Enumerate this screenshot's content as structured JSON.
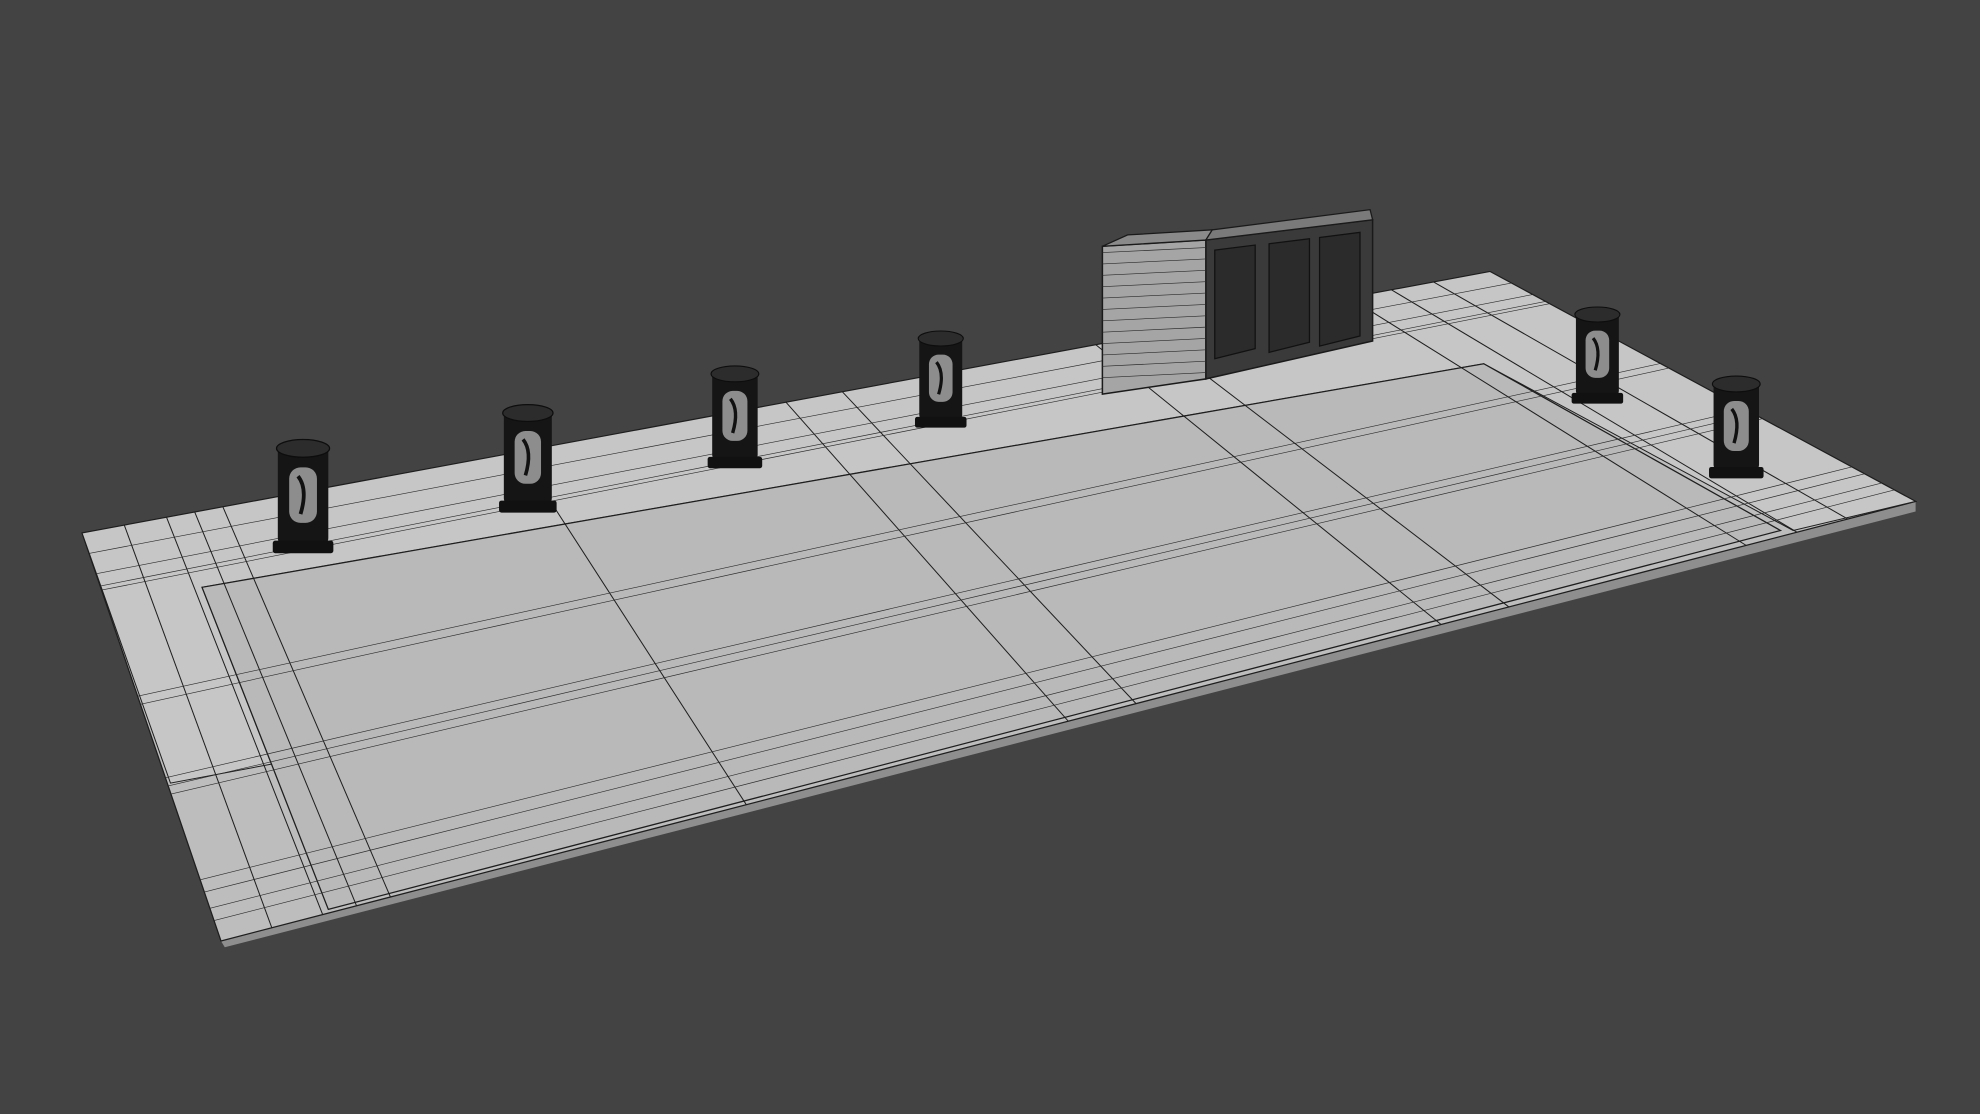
{
  "scene": {
    "subject": "ev-charging-station-wireframe-render",
    "colors": {
      "background": "#434343",
      "floor": "#bdbdbd",
      "floor_edge": "#8e8e8e",
      "wire": "#1e1e1e",
      "charger": "#141414",
      "cabinet": "#9a9a9a"
    },
    "charger_count": 6,
    "cabinet_units": 4
  }
}
